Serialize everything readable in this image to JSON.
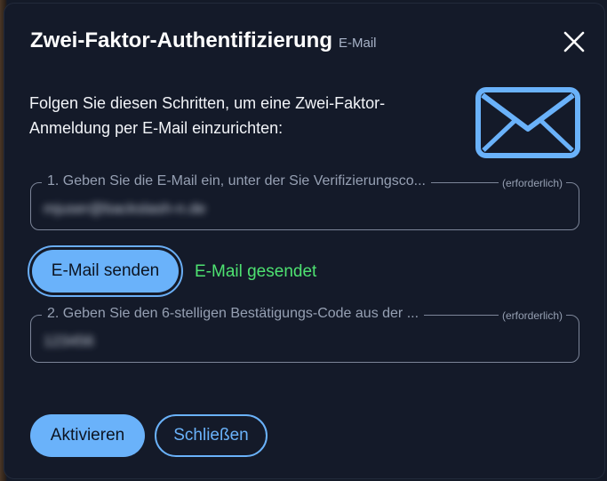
{
  "dialog": {
    "title": "Zwei-Faktor-Authentifizierung",
    "subtitle": "E-Mail",
    "close_icon": "close-icon",
    "intro_text": "Folgen Sie diesen Schritten, um eine Zwei-Faktor-Anmeldung per E-Mail einzurichten:",
    "illustration_icon": "envelope-icon"
  },
  "step1": {
    "label": "1. Geben Sie die E-Mail ein, unter der Sie Verifizierungsco...",
    "required": "(erforderlich)",
    "value": "mjuser@backslash-n.de"
  },
  "send": {
    "button_label": "E-Mail senden",
    "status": "E-Mail gesendet"
  },
  "step2": {
    "label": "2. Geben Sie den 6-stelligen Bestätigungs-Code aus der ...",
    "required": "(erforderlich)",
    "value": "123456"
  },
  "footer": {
    "activate_label": "Aktivieren",
    "close_label": "Schließen"
  },
  "colors": {
    "dialog_bg": "#141a29",
    "accent": "#6ab2fa",
    "success": "#4ee271",
    "text": "#ffffff",
    "muted": "#96a0b3"
  }
}
